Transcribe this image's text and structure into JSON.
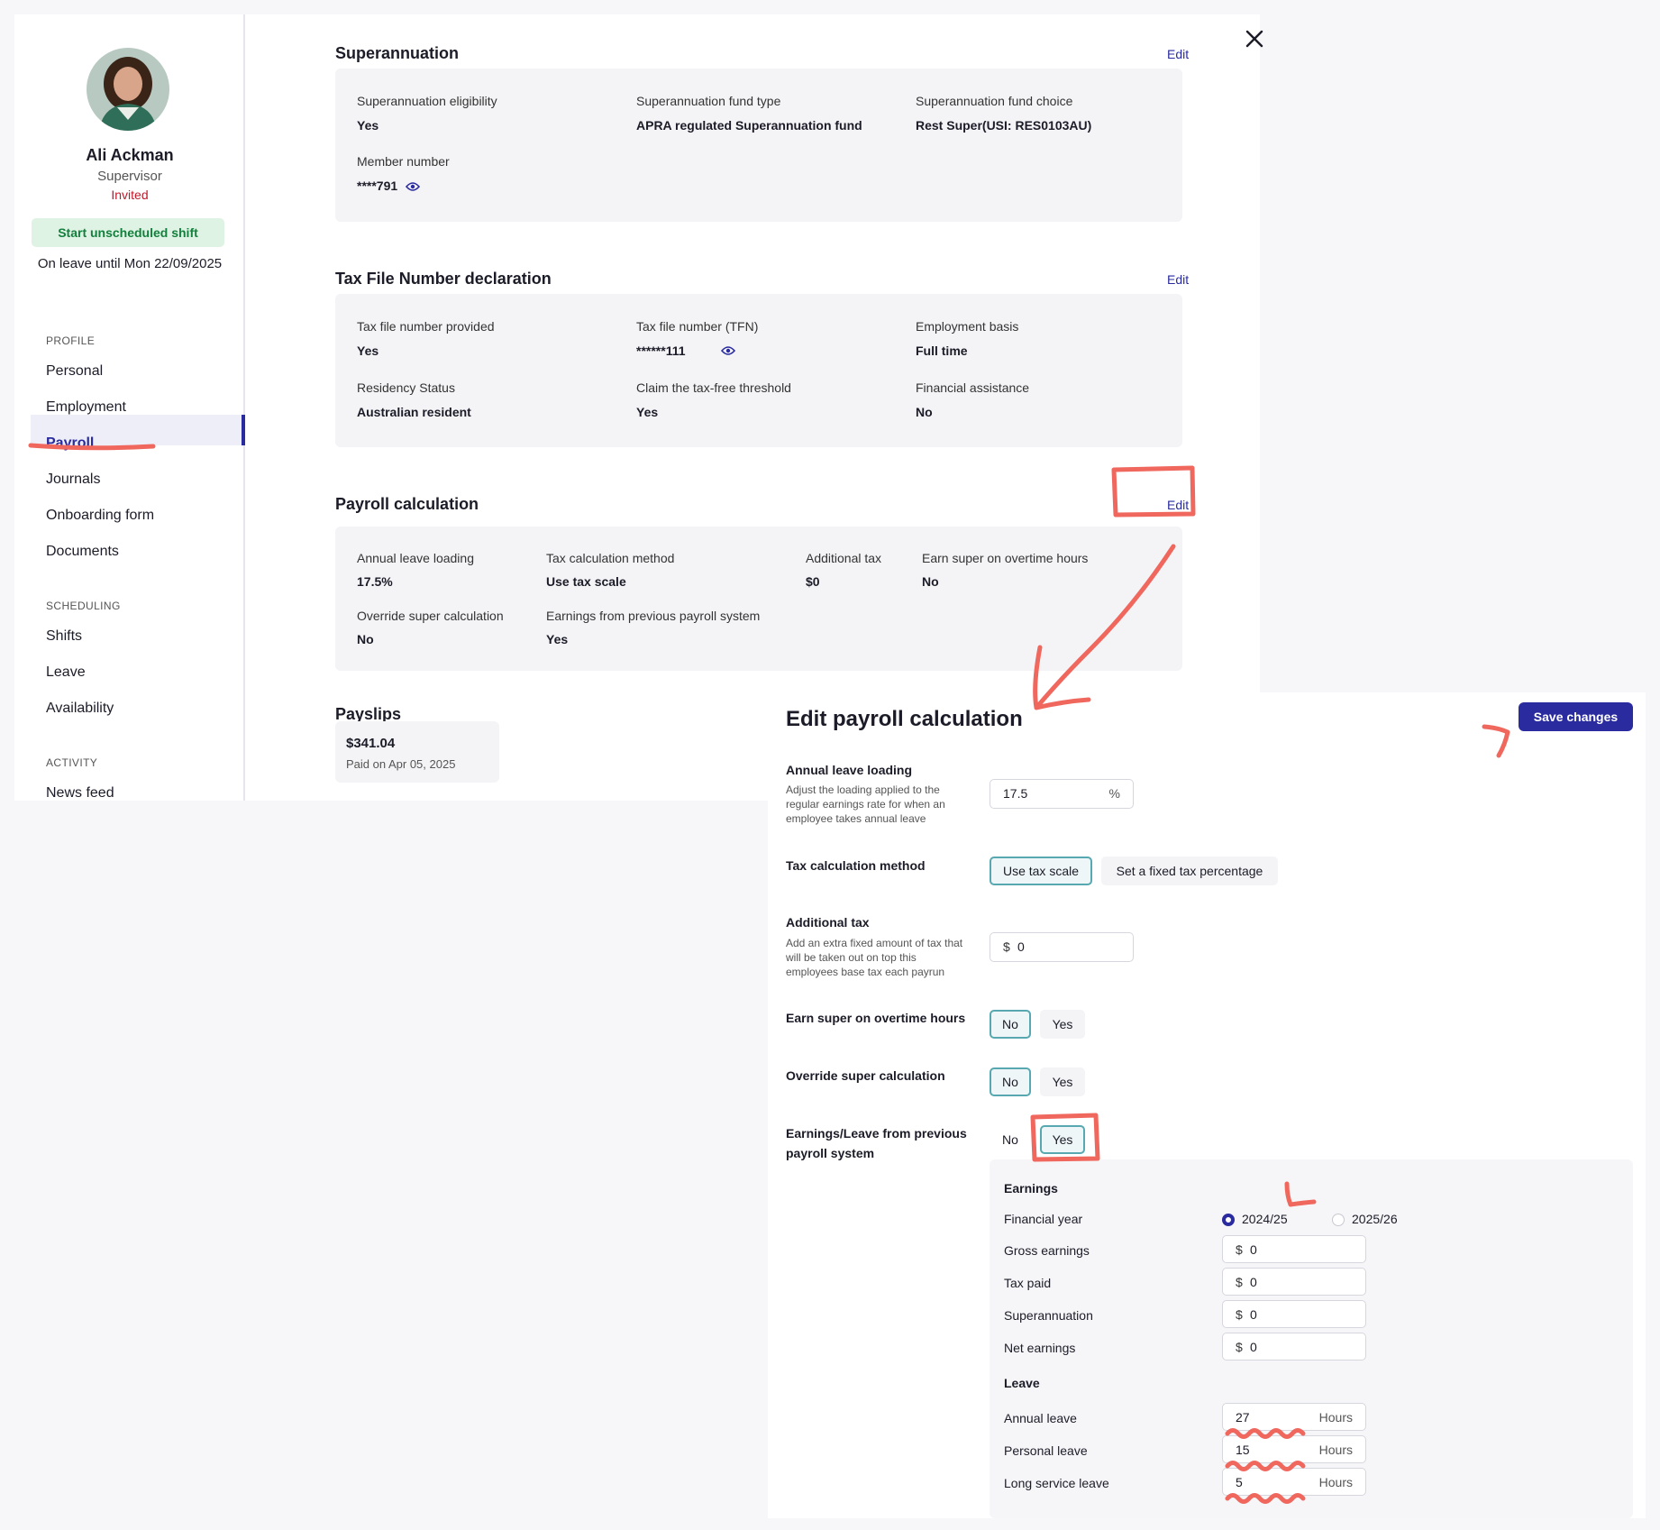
{
  "profile": {
    "name": "Ali Ackman",
    "role": "Supervisor",
    "status": "Invited",
    "start_shift_label": "Start unscheduled shift",
    "leave_until": "On leave until Mon 22/09/2025"
  },
  "nav": {
    "profile_heading": "PROFILE",
    "profile_items": [
      "Personal",
      "Employment",
      "Payroll",
      "Journals",
      "Onboarding form",
      "Documents"
    ],
    "scheduling_heading": "SCHEDULING",
    "scheduling_items": [
      "Shifts",
      "Leave",
      "Availability"
    ],
    "activity_heading": "ACTIVITY",
    "activity_items": [
      "News feed"
    ],
    "active": "Payroll"
  },
  "superannuation": {
    "title": "Superannuation",
    "edit_label": "Edit",
    "eligibility_label": "Superannuation eligibility",
    "eligibility_value": "Yes",
    "fund_type_label": "Superannuation fund type",
    "fund_type_value": "APRA regulated Superannuation fund",
    "fund_choice_label": "Superannuation fund choice",
    "fund_choice_value": "Rest Super(USI: RES0103AU)",
    "member_label": "Member number",
    "member_value": "****791"
  },
  "tfn": {
    "title": "Tax File Number declaration",
    "edit_label": "Edit",
    "provided_label": "Tax file number provided",
    "provided_value": "Yes",
    "tfn_label": "Tax file number (TFN)",
    "tfn_value": "******111",
    "basis_label": "Employment basis",
    "basis_value": "Full time",
    "residency_label": "Residency Status",
    "residency_value": "Australian resident",
    "threshold_label": "Claim the tax-free threshold",
    "threshold_value": "Yes",
    "assistance_label": "Financial assistance",
    "assistance_value": "No"
  },
  "payroll_calc": {
    "title": "Payroll calculation",
    "edit_label": "Edit",
    "leave_loading_label": "Annual leave loading",
    "leave_loading_value": "17.5%",
    "tax_method_label": "Tax calculation method",
    "tax_method_value": "Use tax scale",
    "additional_tax_label": "Additional tax",
    "additional_tax_value": "$0",
    "earn_super_label": "Earn super on overtime hours",
    "earn_super_value": "No",
    "override_label": "Override super calculation",
    "override_value": "No",
    "prev_system_label": "Earnings from previous payroll system",
    "prev_system_value": "Yes"
  },
  "payslips": {
    "title": "Payslips",
    "amount": "$341.04",
    "paid_on": "Paid on Apr 05, 2025"
  },
  "edit_panel": {
    "title": "Edit payroll calculation",
    "save_label": "Save changes",
    "leave_loading_label": "Annual leave loading",
    "leave_loading_desc": "Adjust the loading applied to the regular earnings rate for when an employee takes annual leave",
    "leave_loading_value": "17.5",
    "leave_loading_suffix": "%",
    "tax_method_label": "Tax calculation method",
    "tax_method_options": [
      "Use tax scale",
      "Set a fixed tax percentage"
    ],
    "additional_tax_label": "Additional tax",
    "additional_tax_desc": "Add an extra fixed amount of tax that will be taken out on top this employees base tax each payrun",
    "currency": "$",
    "additional_tax_value": "0",
    "earn_super_label": "Earn super on overtime hours",
    "override_label": "Override super calculation",
    "prev_system_label": "Earnings/Leave from previous payroll system",
    "no_label": "No",
    "yes_label": "Yes",
    "earnings_heading": "Earnings",
    "financial_year_label": "Financial year",
    "fy_options": [
      "2024/25",
      "2025/26"
    ],
    "fy_selected": "2024/25",
    "gross_label": "Gross earnings",
    "gross_value": "0",
    "tax_paid_label": "Tax paid",
    "tax_paid_value": "0",
    "super_label": "Superannuation",
    "super_value": "0",
    "net_label": "Net earnings",
    "net_value": "0",
    "leave_heading": "Leave",
    "annual_leave_label": "Annual leave",
    "annual_leave_value": "27",
    "personal_leave_label": "Personal leave",
    "personal_leave_value": "15",
    "long_service_label": "Long service leave",
    "long_service_value": "5",
    "hours_unit": "Hours"
  },
  "colors": {
    "accent": "#2a2b9e",
    "annotation": "#f0675e",
    "success": "#12803c",
    "danger": "#c0192a",
    "selected_outline": "#57a8b0"
  }
}
